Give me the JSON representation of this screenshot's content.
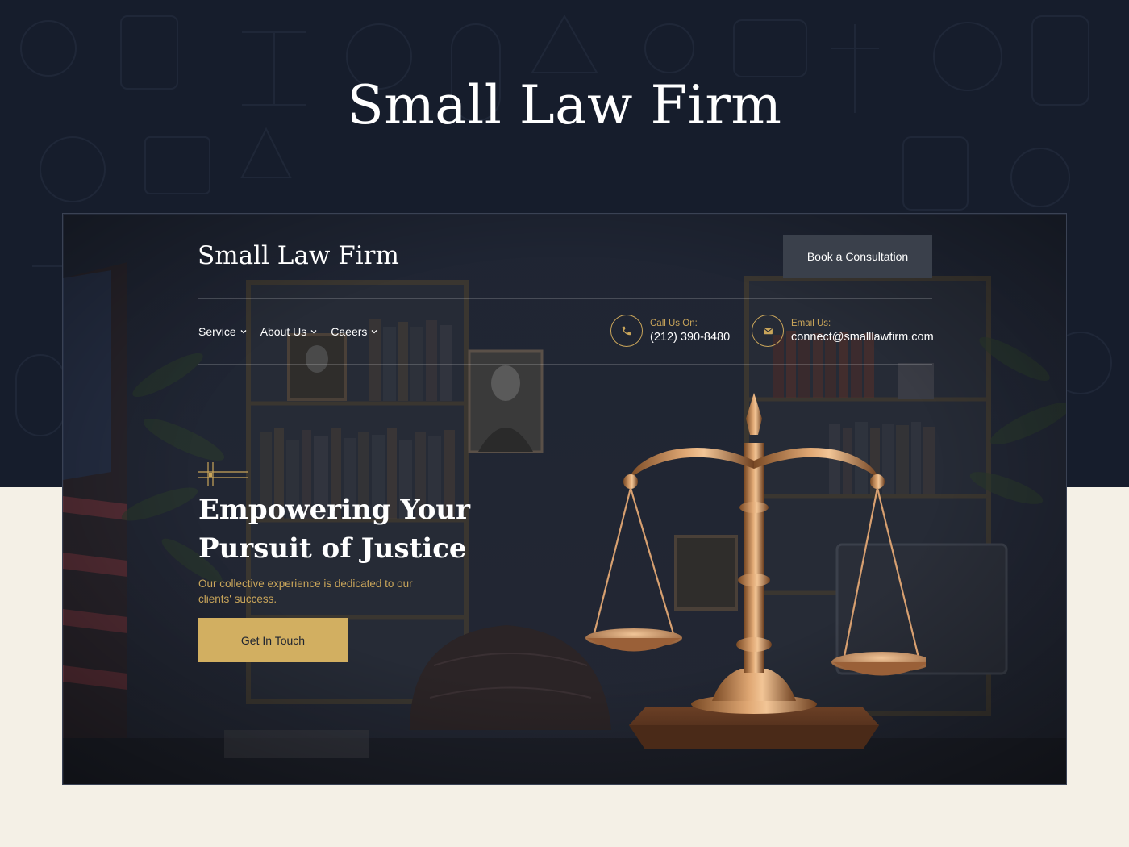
{
  "showcase": {
    "title": "Small Law Firm"
  },
  "header": {
    "logo": "Small Law Firm",
    "cta_label": "Book a Consultation"
  },
  "nav": {
    "items": [
      {
        "label": "Service"
      },
      {
        "label": "About Us"
      },
      {
        "label": "Caeers"
      }
    ]
  },
  "contacts": {
    "phone": {
      "label": "Call Us On:",
      "value": "(212) 390-8480",
      "icon": "phone-icon"
    },
    "email": {
      "label": "Email Us:",
      "value": "connect@smalllawfirm.com",
      "icon": "mail-icon"
    }
  },
  "hero": {
    "title_line1": "Empowering Your",
    "title_line2": "Pursuit of Justice",
    "subtitle": "Our collective experience is dedicated to our clients' success.",
    "cta_label": "Get In Touch"
  },
  "colors": {
    "dark_navy": "#161d2c",
    "cream": "#f4f0e6",
    "gold": "#c9a55a",
    "button_gold": "#d2af61",
    "button_gray": "#3a404b"
  }
}
